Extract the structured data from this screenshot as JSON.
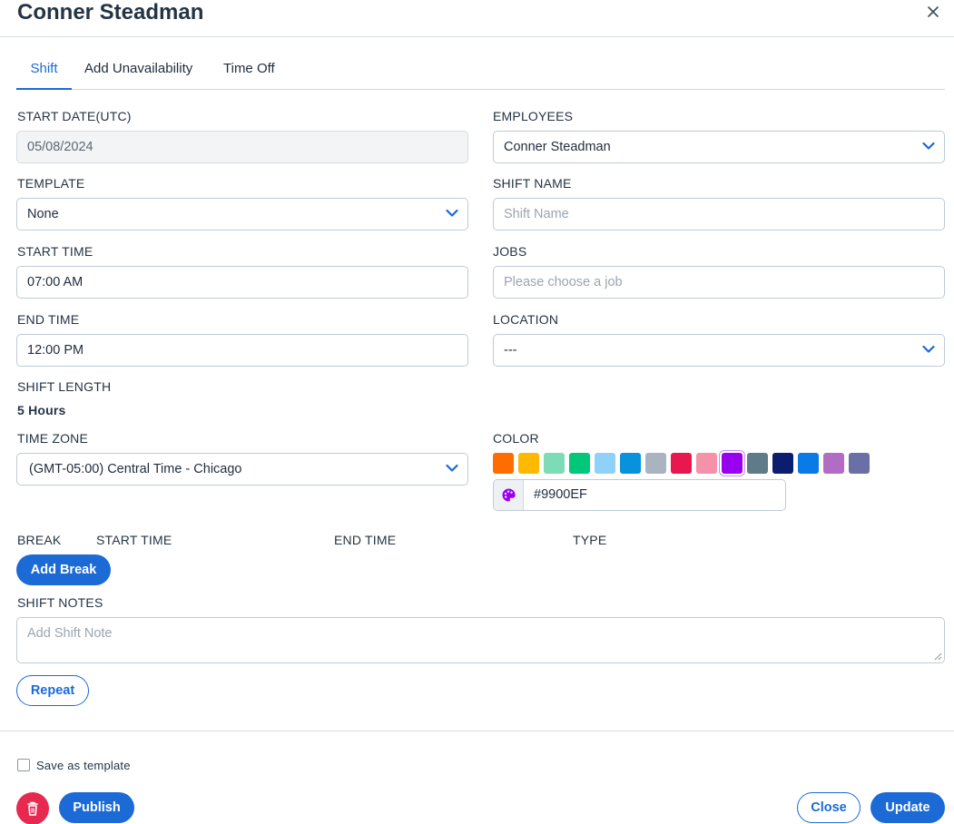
{
  "header": {
    "title": "Conner Steadman"
  },
  "tabs": [
    {
      "label": "Shift",
      "active": true
    },
    {
      "label": "Add Unavailability",
      "active": false
    },
    {
      "label": "Time Off",
      "active": false
    }
  ],
  "form": {
    "start_date": {
      "label": "START DATE(UTC)",
      "value": "05/08/2024"
    },
    "employees": {
      "label": "EMPLOYEES",
      "value": "Conner Steadman"
    },
    "template": {
      "label": "TEMPLATE",
      "value": "None"
    },
    "shift_name": {
      "label": "SHIFT NAME",
      "placeholder": "Shift Name"
    },
    "start_time": {
      "label": "START TIME",
      "value": "07:00 AM"
    },
    "jobs": {
      "label": "JOBS",
      "placeholder": "Please choose a job"
    },
    "end_time": {
      "label": "END TIME",
      "value": "12:00 PM"
    },
    "location": {
      "label": "LOCATION",
      "value": "---"
    },
    "shift_length": {
      "label": "SHIFT LENGTH",
      "value": "5 Hours"
    },
    "time_zone": {
      "label": "TIME ZONE",
      "value": "(GMT-05:00) Central Time - Chicago"
    },
    "color": {
      "label": "COLOR",
      "swatches": [
        "#ff6d00",
        "#ffb800",
        "#7ddbb5",
        "#00c77a",
        "#8fd1f8",
        "#0891dc",
        "#aab4c0",
        "#e8174d",
        "#f591a8",
        "#9900ef",
        "#5f7b8a",
        "#0b1d6e",
        "#0a7ae6",
        "#b36cc4",
        "#6a6fa8"
      ],
      "selected": "#9900EF",
      "hex_value": "#9900EF"
    }
  },
  "breaks": {
    "columns": [
      "BREAK",
      "START TIME",
      "END TIME",
      "TYPE"
    ],
    "add_label": "Add Break"
  },
  "notes": {
    "label": "SHIFT NOTES",
    "placeholder": "Add Shift Note"
  },
  "repeat_label": "Repeat",
  "footer": {
    "save_template_label": "Save as template",
    "publish_label": "Publish",
    "close_label": "Close",
    "update_label": "Update"
  },
  "colors": {
    "accent": "#1b6ad6",
    "danger": "#e8294f"
  }
}
